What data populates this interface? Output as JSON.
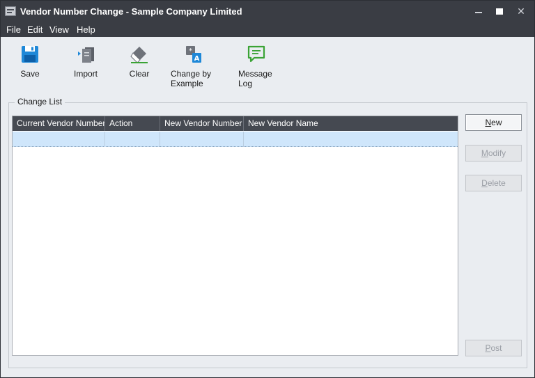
{
  "window": {
    "title": "Vendor Number Change - Sample Company Limited",
    "close_glyph": "✕"
  },
  "menu": [
    "File",
    "Edit",
    "View",
    "Help"
  ],
  "toolbar": {
    "save": {
      "label": "Save",
      "icon": "floppy-disk-icon"
    },
    "import": {
      "label": "Import",
      "icon": "import-document-icon"
    },
    "clear": {
      "label": "Clear",
      "icon": "eraser-icon"
    },
    "change_by_example": {
      "line1": "Change by",
      "line2": "Example",
      "icon": "translate-icon"
    },
    "message_log": {
      "line1": "Message",
      "line2": "Log",
      "icon": "speech-bubble-icon"
    }
  },
  "change_list": {
    "title": "Change List",
    "columns": [
      "Current Vendor Number",
      "Action",
      "New Vendor Number",
      "New Vendor Name"
    ],
    "rows": [
      [
        "",
        "",
        "",
        ""
      ]
    ]
  },
  "buttons": {
    "new": {
      "first": "N",
      "rest": "ew",
      "enabled": true
    },
    "modify": {
      "first": "M",
      "rest": "odify",
      "enabled": false
    },
    "delete": {
      "first": "D",
      "rest": "elete",
      "enabled": false
    },
    "post": {
      "first": "P",
      "rest": "ost",
      "enabled": false
    }
  },
  "colors": {
    "titlebar": "#3a3d44",
    "grid_header": "#454951",
    "selected_row": "#cfe6fb",
    "save_icon": "#1e88d8",
    "message_icon": "#3aa335"
  }
}
